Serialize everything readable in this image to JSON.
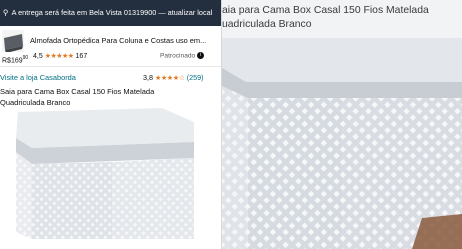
{
  "topbar": {
    "delivery_text": "A entrega será feita em Bela Vista 01319900 — atualizar local"
  },
  "ad": {
    "title": "Almofada Ortopédica Para Coluna e Costas uso em...",
    "price_whole": "169",
    "price_cents": "90",
    "rating": "4,5",
    "stars": "★★★★★",
    "reviews": "167",
    "sponsored_label": "Patrocinado"
  },
  "product": {
    "store_link": "Visite a loja Casaborda",
    "rating": "3,8",
    "stars": "★★★★☆",
    "reviews": "(259)",
    "title_line1": "Saia para Cama Box Casal 150 Fios Matelada",
    "title_line2": "Quadriculada Branco"
  },
  "zoom": {
    "title_line1": "aia para Cama Box Casal 150 Fios Matelada",
    "title_line2": "uadriculada Branco"
  },
  "colors": {
    "topbar_bg": "#232f3e",
    "link": "#007185",
    "star": "#de7921"
  }
}
